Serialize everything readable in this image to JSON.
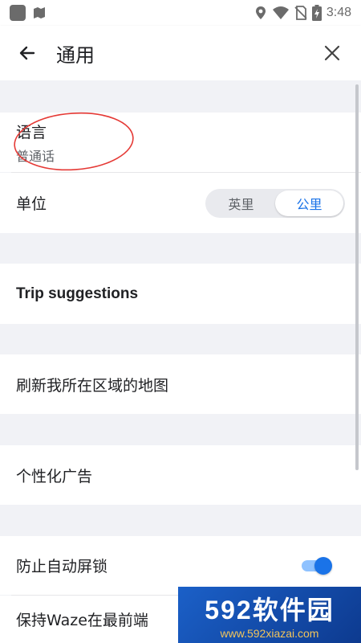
{
  "status_bar": {
    "time": "3:48"
  },
  "header": {
    "title": "通用"
  },
  "language": {
    "label": "语言",
    "value": "普通话"
  },
  "unit": {
    "label": "单位",
    "options": [
      "英里",
      "公里"
    ],
    "selected": "公里"
  },
  "trip": {
    "label": "Trip suggestions"
  },
  "refresh": {
    "label": "刷新我所在区域的地图"
  },
  "ads": {
    "label": "个性化广告"
  },
  "autolock": {
    "label": "防止自动屏锁",
    "enabled": true
  },
  "keep_front": {
    "label": "保持Waze在最前端"
  },
  "watermark": {
    "logo": "592软件园",
    "url": "www.592xiazai.com"
  },
  "colors": {
    "accent": "#1a73e8",
    "annotation": "#e53935"
  }
}
